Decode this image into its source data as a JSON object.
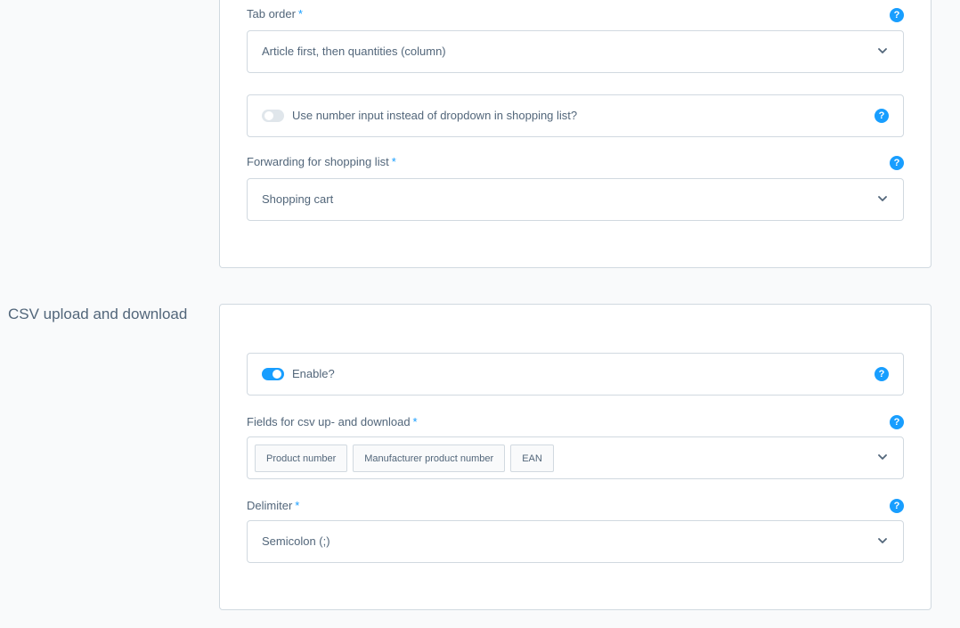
{
  "shopping_list_settings": {
    "tab_order": {
      "label": "Tab order",
      "required_mark": "*",
      "value": "Article first, then quantities (column)",
      "help_icon": "help-icon"
    },
    "number_input_switch": {
      "label": "Use number input instead of dropdown in shopping list?",
      "enabled": false,
      "help_icon": "help-icon"
    },
    "forwarding": {
      "label": "Forwarding for shopping list",
      "required_mark": "*",
      "value": "Shopping cart",
      "help_icon": "help-icon"
    }
  },
  "csv_section": {
    "title": "CSV upload and download",
    "enable_switch": {
      "label": "Enable?",
      "enabled": true,
      "help_icon": "help-icon"
    },
    "fields": {
      "label": "Fields for csv up- and download",
      "required_mark": "*",
      "selected": [
        "Product number",
        "Manufacturer product number",
        "EAN"
      ],
      "help_icon": "help-icon"
    },
    "delimiter": {
      "label": "Delimiter",
      "required_mark": "*",
      "value": "Semicolon (;)",
      "help_icon": "help-icon"
    }
  },
  "colors": {
    "accent": "#189eff",
    "text": "#52667a",
    "border": "#d1d9e0",
    "background": "#f9fafb"
  },
  "help_glyph": "?"
}
